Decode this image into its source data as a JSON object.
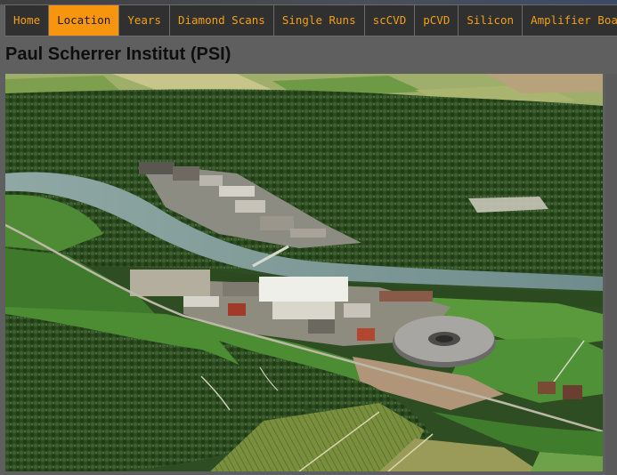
{
  "nav": {
    "items": [
      {
        "label": "Home",
        "active": false
      },
      {
        "label": "Location",
        "active": true
      },
      {
        "label": "Years",
        "active": false
      },
      {
        "label": "Diamond Scans",
        "active": false
      },
      {
        "label": "Single Runs",
        "active": false
      },
      {
        "label": "scCVD",
        "active": false
      },
      {
        "label": "pCVD",
        "active": false
      },
      {
        "label": "Silicon",
        "active": false
      },
      {
        "label": "Amplifier Boards",
        "active": false
      }
    ],
    "accent_color": "#f7960e",
    "text_color": "#f3a018",
    "background_color": "#303030"
  },
  "page": {
    "title": "Paul Scherrer Institut (PSI)",
    "background_color": "#5f5f5f"
  }
}
